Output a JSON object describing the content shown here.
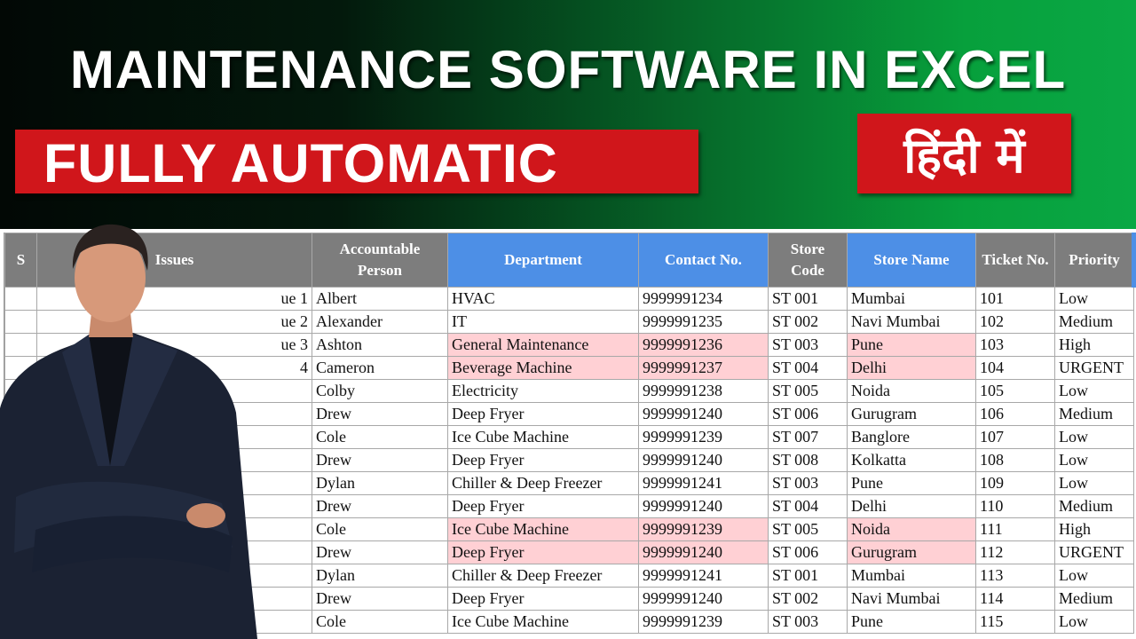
{
  "banner": {
    "title": "MAINTENANCE SOFTWARE IN EXCEL",
    "left_box": "FULLY AUTOMATIC",
    "right_box": "हिंदी में",
    "colors": {
      "red": "#d0161b",
      "green": "#0aa845",
      "dark": "#020805"
    }
  },
  "table": {
    "headers": [
      "S",
      "Issues",
      "Accountable Person",
      "Department",
      "Contact No.",
      "Store Code",
      "Store Name",
      "Ticket No.",
      "Priority"
    ],
    "rows": [
      {
        "issue": "ue 1",
        "person": "Albert",
        "dept": "HVAC",
        "contact": "9999991234",
        "code": "ST 001",
        "store": "Mumbai",
        "ticket": "101",
        "priority": "Low"
      },
      {
        "issue": "ue 2",
        "person": "Alexander",
        "dept": "IT",
        "contact": "9999991235",
        "code": "ST 002",
        "store": "Navi Mumbai",
        "ticket": "102",
        "priority": "Medium"
      },
      {
        "issue": "ue 3",
        "person": "Ashton",
        "dept": "General Maintenance",
        "contact": "9999991236",
        "code": "ST 003",
        "store": "Pune",
        "ticket": "103",
        "priority": "High"
      },
      {
        "issue": "4",
        "person": "Cameron",
        "dept": "Beverage Machine",
        "contact": "9999991237",
        "code": "ST 004",
        "store": "Delhi",
        "ticket": "104",
        "priority": "URGENT"
      },
      {
        "issue": "",
        "person": "Colby",
        "dept": "Electricity",
        "contact": "9999991238",
        "code": "ST 005",
        "store": "Noida",
        "ticket": "105",
        "priority": "Low"
      },
      {
        "issue": "",
        "person": "Drew",
        "dept": "Deep Fryer",
        "contact": "9999991240",
        "code": "ST 006",
        "store": "Gurugram",
        "ticket": "106",
        "priority": "Medium"
      },
      {
        "issue": "",
        "person": "Cole",
        "dept": "Ice Cube Machine",
        "contact": "9999991239",
        "code": "ST 007",
        "store": "Banglore",
        "ticket": "107",
        "priority": "Low"
      },
      {
        "issue": "",
        "person": "Drew",
        "dept": "Deep Fryer",
        "contact": "9999991240",
        "code": "ST 008",
        "store": "Kolkatta",
        "ticket": "108",
        "priority": "Low"
      },
      {
        "issue": "",
        "person": "Dylan",
        "dept": "Chiller & Deep Freezer",
        "contact": "9999991241",
        "code": "ST 003",
        "store": "Pune",
        "ticket": "109",
        "priority": "Low"
      },
      {
        "issue": "",
        "person": "Drew",
        "dept": "Deep Fryer",
        "contact": "9999991240",
        "code": "ST 004",
        "store": "Delhi",
        "ticket": "110",
        "priority": "Medium"
      },
      {
        "issue": "",
        "person": "Cole",
        "dept": "Ice Cube Machine",
        "contact": "9999991239",
        "code": "ST 005",
        "store": "Noida",
        "ticket": "111",
        "priority": "High"
      },
      {
        "issue": "",
        "person": "Drew",
        "dept": "Deep Fryer",
        "contact": "9999991240",
        "code": "ST 006",
        "store": "Gurugram",
        "ticket": "112",
        "priority": "URGENT"
      },
      {
        "issue": "",
        "person": "Dylan",
        "dept": "Chiller & Deep Freezer",
        "contact": "9999991241",
        "code": "ST 001",
        "store": "Mumbai",
        "ticket": "113",
        "priority": "Low"
      },
      {
        "issue": "",
        "person": "Drew",
        "dept": "Deep Fryer",
        "contact": "9999991240",
        "code": "ST 002",
        "store": "Navi Mumbai",
        "ticket": "114",
        "priority": "Medium"
      },
      {
        "issue": "",
        "person": "Cole",
        "dept": "Ice Cube Machine",
        "contact": "9999991239",
        "code": "ST 003",
        "store": "Pune",
        "ticket": "115",
        "priority": "Low"
      }
    ],
    "highlight_rows": [
      2,
      3,
      10,
      11
    ],
    "colors": {
      "header_gray": "#7d7d7d",
      "header_blue": "#4d8fe6",
      "highlight_fill": "#ffd0d4",
      "highlight_text": "#c0262c"
    }
  }
}
